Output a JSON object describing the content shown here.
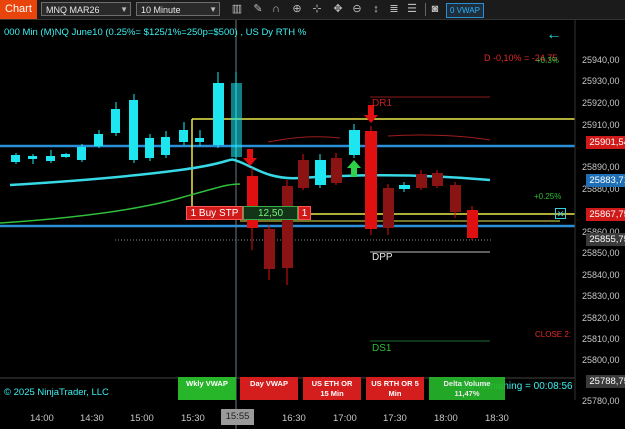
{
  "toolbar": {
    "chart_tab": "Chart",
    "instrument": "MNQ MAR26",
    "interval": "10 Minute",
    "vwap_button": "0 VWAP",
    "tools": [
      "bars-icon",
      "pencil-icon",
      "magnet-icon",
      "zoom-in-icon",
      "crosshair-icon",
      "move-icon",
      "zoom-out-icon",
      "trade-icon",
      "list-icon",
      "properties-icon",
      "grid-icon",
      "camera-icon"
    ]
  },
  "chart": {
    "title": "000 Min (M)NQ June10 (0.25%= $125/1%=250p=$500) , US Dy RTH %",
    "copyright": "© 2025 NinjaTrader, LLC",
    "countdown": "Bar remaining = 00:08:56",
    "cursor_time": "15:55",
    "x_ticks": [
      "14:00",
      "14:30",
      "15:00",
      "15:30",
      "16:30",
      "17:00",
      "17:30",
      "18:00",
      "18:30"
    ],
    "y_ticks": [
      "25940,00",
      "25930,00",
      "25920,00",
      "25910,00",
      "25890,00",
      "25880,00",
      "25860,00",
      "25850,00",
      "25840,00",
      "25830,00",
      "25820,00",
      "25810,00",
      "25800,00",
      "25780,00"
    ],
    "price_labels": [
      {
        "text": "25901,54",
        "color": "#d01a1a"
      },
      {
        "text": "25883,71",
        "color": "#1e6fb5"
      },
      {
        "text": "25867,75",
        "color": "#d01a1a"
      },
      {
        "text": "25855,75",
        "color": "#3a3a3a"
      },
      {
        "text": "25788,75",
        "color": "#3a3a3a"
      }
    ],
    "labels": {
      "dr1": "DR1",
      "dpp": "DPP",
      "ds1": "DS1",
      "daily_change": "D -0,10% = -24,75",
      "plus_03": "+0.3%",
      "plus_025": "+0.25%",
      "close": "CLOSE 2:"
    },
    "order": {
      "type": "1 Buy STP",
      "price": "12,50",
      "qty": "1"
    },
    "buttons": [
      {
        "line1": "Wkly VWAP",
        "line2": "",
        "color": "#27b62a"
      },
      {
        "line1": "Day VWAP",
        "line2": "",
        "color": "#d41d1d"
      },
      {
        "line1": "US ETH OR",
        "line2": "15 Min",
        "color": "#d41d1d"
      },
      {
        "line1": "US RTH OR 5",
        "line2": "Min",
        "color": "#d41d1d"
      },
      {
        "line1": "Delta Volume",
        "line2": "11,47%",
        "color": "#27b62a"
      }
    ],
    "colors": {
      "bull": "#1ee6f0",
      "bear": "#e01010",
      "bear_dark": "#8a1414",
      "blue_line": "#2a8fd8",
      "yellow_line": "#e8e84a"
    }
  }
}
